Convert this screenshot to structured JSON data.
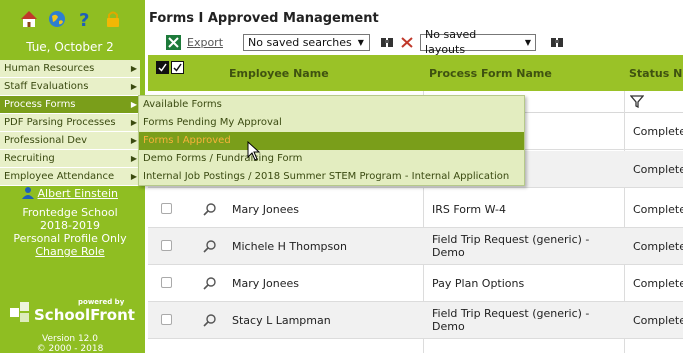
{
  "sidebar": {
    "date": "Tue, October 2",
    "menu": [
      {
        "label": "Human Resources"
      },
      {
        "label": "Staff Evaluations"
      },
      {
        "label": "Process Forms"
      },
      {
        "label": "PDF Parsing Processes"
      },
      {
        "label": "Professional Dev"
      },
      {
        "label": "Recruiting"
      },
      {
        "label": "Employee Attendance"
      }
    ],
    "user": {
      "name": "Albert Einstein",
      "school": "Frontedge School",
      "year": "2018-2019",
      "profile": "Personal Profile Only",
      "change_role": "Change Role"
    },
    "logo": {
      "powered_by": "powered by",
      "brand": "SchoolFront"
    },
    "version": "Version 12.0",
    "copyright": "© 2000 - 2018"
  },
  "header": {
    "title": "Forms I Approved Management",
    "export_label": "Export",
    "saved_searches": "No saved searches",
    "saved_layouts": "No saved layouts"
  },
  "table": {
    "columns": {
      "employee": "Employee Name",
      "process": "Process Form Name",
      "status": "Status N"
    },
    "rows": [
      {
        "employee": "",
        "process": "",
        "status": "Complete"
      },
      {
        "employee": "",
        "process": "",
        "status": "Complete"
      },
      {
        "employee": "Mary Jonees",
        "process": "IRS Form W-4",
        "status": "Complete"
      },
      {
        "employee": "Michele H Thompson",
        "process": "Field Trip Request (generic) - Demo",
        "status": "Complete"
      },
      {
        "employee": "Mary Jonees",
        "process": "Pay Plan Options",
        "status": "Complete"
      },
      {
        "employee": "Stacy L Lampman",
        "process": "Field Trip Request (generic) - Demo",
        "status": "Complete"
      }
    ]
  },
  "submenu": [
    {
      "label": "Available Forms"
    },
    {
      "label": "Forms Pending My Approval"
    },
    {
      "label": "Forms I Approved"
    },
    {
      "label": "Demo Forms / Fundraising Form"
    },
    {
      "label": "Internal Job Postings / 2018 Summer STEM Program - Internal Application"
    }
  ],
  "colors": {
    "sidebar_green": "#8fbe22",
    "header_green": "#9ac227",
    "active_item": "#7a9e1a",
    "active_text": "#f6b23a"
  }
}
